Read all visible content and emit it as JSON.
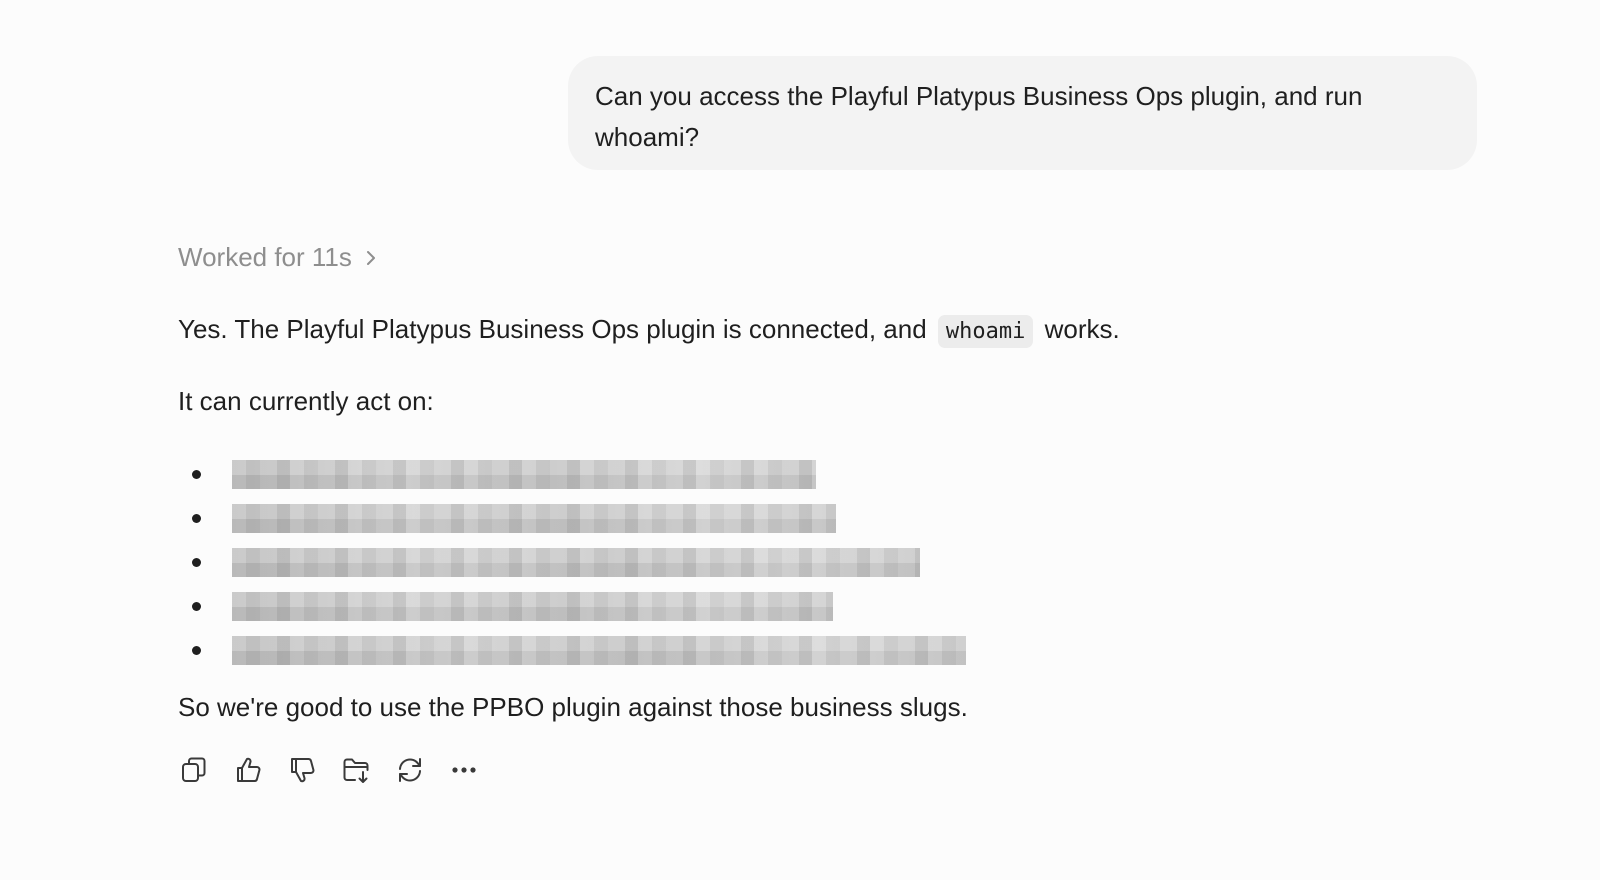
{
  "user_message": {
    "line1": "Can you access the Playful Platypus Business Ops plugin, and run",
    "line2": "whoami?"
  },
  "assistant": {
    "worked_label": "Worked for 11s",
    "intro_before": "Yes. The Playful Platypus Business Ops plugin is connected, and",
    "intro_code": "whoami",
    "intro_after": "works.",
    "list_heading": "It can currently act on:",
    "list_items_redacted": 5,
    "closing": "So we're good to use the PPBO plugin against those business slugs."
  },
  "actions": [
    {
      "icon": "copy-icon"
    },
    {
      "icon": "thumbs-up-icon"
    },
    {
      "icon": "thumbs-down-icon"
    },
    {
      "icon": "save-to-folder-icon"
    },
    {
      "icon": "regenerate-icon"
    },
    {
      "icon": "more-options-icon"
    }
  ]
}
